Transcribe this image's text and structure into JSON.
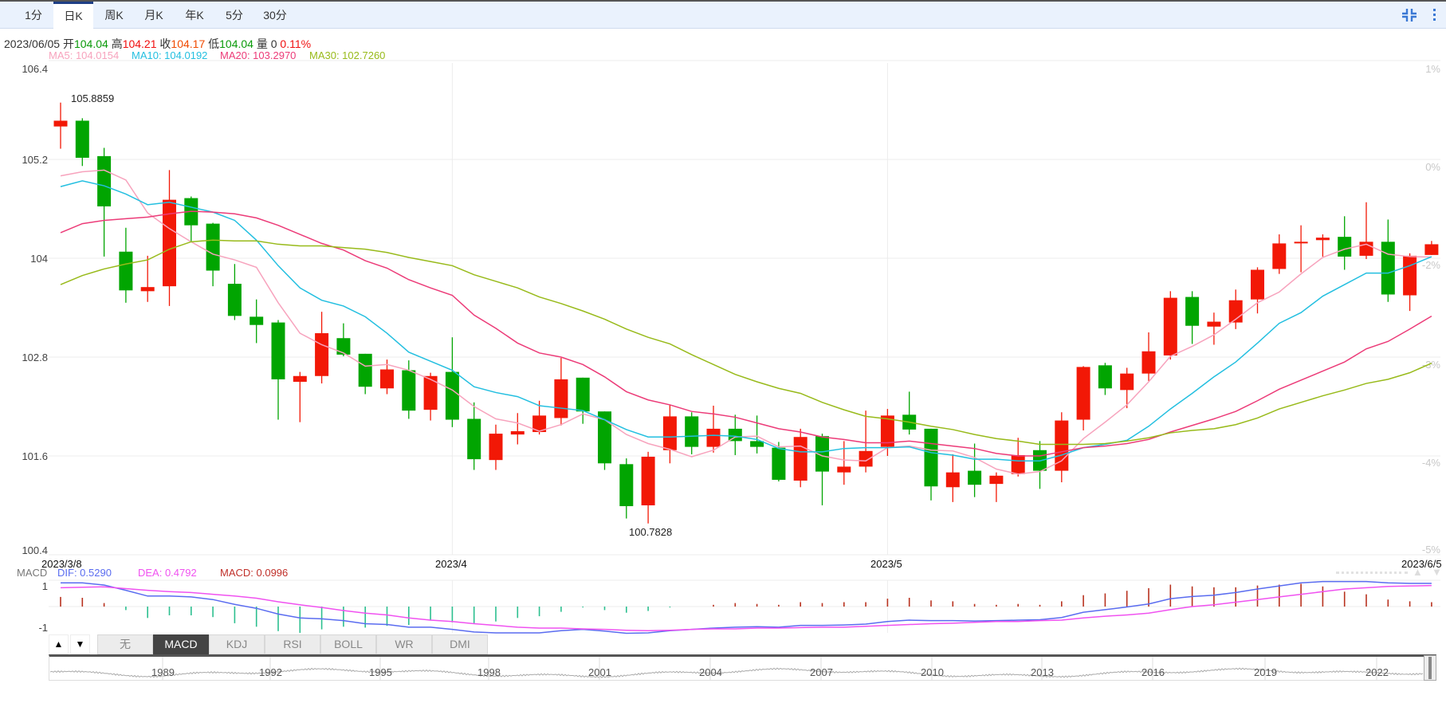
{
  "tabs": [
    "1分",
    "日K",
    "周K",
    "月K",
    "年K",
    "5分",
    "30分"
  ],
  "active_tab": 1,
  "icons": {
    "compress": "compress-icon",
    "more": "kebab-menu-icon"
  },
  "info": {
    "date": "2023/06/05",
    "open_label": "开",
    "open": "104.04",
    "high_label": "高",
    "high": "104.21",
    "close_label": "收",
    "close": "104.17",
    "low_label": "低",
    "low": "104.04",
    "vol_label": "量",
    "vol": "0",
    "change": "0.11%"
  },
  "ma_legend": {
    "ma5": "MA5: 104.0154",
    "ma10": "MA10: 104.0192",
    "ma20": "MA20: 103.2970",
    "ma30": "MA30: 102.7260"
  },
  "colors": {
    "up": "#f21806",
    "down": "#01a501",
    "ma5": "#f7a3bd",
    "ma10": "#23bfe0",
    "ma20": "#ec3b78",
    "ma30": "#98ba1a",
    "dif": "#5a6cf0",
    "dea": "#f052f0",
    "hist_up": "#b8321f",
    "hist_down": "#2cbf8f"
  },
  "chart_data": [
    {
      "type": "candlestick",
      "title": "日K",
      "y_ticks": [
        "106.4",
        "105.2",
        "104",
        "102.8",
        "101.6",
        "100.4"
      ],
      "y_tick_values": [
        106.4,
        105.2,
        104,
        102.8,
        101.6,
        100.4
      ],
      "ylim": [
        100.4,
        106.4
      ],
      "pct_ticks": [
        "1%",
        "0%",
        "-2%",
        "-3%",
        "-4%",
        "-5%"
      ],
      "x_labels": [
        "2023/3/8",
        "2023/4",
        "2023/5",
        "2023/6/5"
      ],
      "x_label_index": [
        0,
        18,
        38,
        63
      ],
      "max_label": "105.8859",
      "max_index": 0,
      "min_label": "100.7828",
      "min_index": 27,
      "grid": true,
      "ohlc": [
        [
          105.6,
          105.89,
          105.33,
          105.67
        ],
        [
          105.67,
          105.7,
          105.12,
          105.22
        ],
        [
          105.24,
          105.34,
          104.02,
          104.63
        ],
        [
          104.08,
          104.37,
          103.46,
          103.61
        ],
        [
          103.6,
          104.03,
          103.47,
          103.65
        ],
        [
          103.66,
          105.07,
          103.42,
          104.71
        ],
        [
          104.73,
          104.75,
          104.2,
          104.4
        ],
        [
          104.42,
          104.43,
          103.66,
          103.85
        ],
        [
          103.69,
          103.93,
          103.25,
          103.3
        ],
        [
          103.29,
          103.5,
          102.97,
          103.19
        ],
        [
          103.22,
          103.25,
          102.04,
          102.53
        ],
        [
          102.5,
          102.62,
          102.01,
          102.57
        ],
        [
          102.57,
          103.35,
          102.48,
          103.09
        ],
        [
          103.03,
          103.21,
          102.81,
          102.83
        ],
        [
          102.84,
          102.84,
          102.35,
          102.44
        ],
        [
          102.42,
          102.77,
          102.35,
          102.65
        ],
        [
          102.64,
          102.76,
          102.05,
          102.15
        ],
        [
          102.16,
          102.61,
          102.03,
          102.57
        ],
        [
          102.62,
          103.04,
          101.95,
          102.04
        ],
        [
          102.05,
          102.25,
          101.43,
          101.56
        ],
        [
          101.55,
          101.98,
          101.43,
          101.87
        ],
        [
          101.86,
          102.12,
          101.74,
          101.9
        ],
        [
          101.89,
          102.27,
          101.86,
          102.09
        ],
        [
          102.06,
          102.79,
          101.97,
          102.53
        ],
        [
          102.55,
          102.55,
          101.99,
          102.14
        ],
        [
          102.14,
          102.14,
          101.43,
          101.51
        ],
        [
          101.5,
          101.57,
          100.84,
          100.99
        ],
        [
          101.0,
          101.65,
          100.78,
          101.59
        ],
        [
          101.67,
          102.22,
          101.51,
          102.08
        ],
        [
          102.08,
          102.13,
          101.62,
          101.71
        ],
        [
          101.71,
          102.21,
          101.64,
          101.93
        ],
        [
          101.93,
          102.1,
          101.61,
          101.78
        ],
        [
          101.78,
          102.09,
          101.63,
          101.71
        ],
        [
          101.7,
          101.77,
          101.29,
          101.31
        ],
        [
          101.3,
          101.93,
          101.22,
          101.83
        ],
        [
          101.84,
          101.87,
          101.0,
          101.41
        ],
        [
          101.4,
          101.78,
          101.25,
          101.47
        ],
        [
          101.47,
          102.15,
          101.4,
          101.66
        ],
        [
          101.71,
          102.17,
          101.6,
          102.09
        ],
        [
          102.1,
          102.38,
          101.86,
          101.92
        ],
        [
          101.93,
          101.93,
          101.06,
          101.23
        ],
        [
          101.22,
          101.62,
          101.04,
          101.4
        ],
        [
          101.42,
          101.75,
          101.1,
          101.25
        ],
        [
          101.26,
          101.4,
          101.04,
          101.36
        ],
        [
          101.38,
          101.82,
          101.35,
          101.61
        ],
        [
          101.67,
          101.78,
          101.2,
          101.42
        ],
        [
          101.42,
          102.13,
          101.28,
          102.03
        ],
        [
          102.04,
          102.69,
          101.91,
          102.68
        ],
        [
          102.7,
          102.73,
          102.34,
          102.42
        ],
        [
          102.4,
          102.67,
          102.18,
          102.6
        ],
        [
          102.6,
          103.1,
          102.51,
          102.87
        ],
        [
          102.82,
          103.6,
          102.77,
          103.52
        ],
        [
          103.53,
          103.6,
          102.96,
          103.18
        ],
        [
          103.17,
          103.34,
          102.95,
          103.23
        ],
        [
          103.22,
          103.62,
          103.14,
          103.49
        ],
        [
          103.5,
          103.89,
          103.33,
          103.86
        ],
        [
          103.87,
          104.29,
          103.81,
          104.18
        ],
        [
          104.19,
          104.4,
          103.83,
          104.2
        ],
        [
          104.22,
          104.29,
          104.02,
          104.25
        ],
        [
          104.26,
          104.51,
          103.86,
          104.02
        ],
        [
          104.03,
          104.68,
          103.99,
          104.2
        ],
        [
          104.2,
          104.47,
          103.47,
          103.56
        ],
        [
          103.55,
          104.06,
          103.36,
          104.03
        ],
        [
          104.04,
          104.21,
          104.04,
          104.17
        ]
      ],
      "series": [
        {
          "name": "MA5",
          "values": [
            105.0,
            105.05,
            105.07,
            104.95,
            104.55,
            104.36,
            104.2,
            104.05,
            103.98,
            103.89,
            103.46,
            103.09,
            102.95,
            102.85,
            102.69,
            102.71,
            102.64,
            102.53,
            102.4,
            102.2,
            102.05,
            102.0,
            101.9,
            101.98,
            102.11,
            102.04,
            101.86,
            101.75,
            101.68,
            101.59,
            101.67,
            101.83,
            101.84,
            101.71,
            101.72,
            101.6,
            101.55,
            101.54,
            101.7,
            101.72,
            101.67,
            101.66,
            101.58,
            101.44,
            101.38,
            101.41,
            101.54,
            101.81,
            102.01,
            102.22,
            102.5,
            102.81,
            102.93,
            103.07,
            103.26,
            103.46,
            103.59,
            103.81,
            104.01,
            104.11,
            104.17,
            104.05,
            104.02,
            104.0154
          ]
        },
        {
          "name": "MA10",
          "values": [
            104.87,
            104.94,
            104.88,
            104.78,
            104.65,
            104.68,
            104.62,
            104.56,
            104.46,
            104.22,
            103.91,
            103.64,
            103.49,
            103.42,
            103.29,
            103.09,
            102.86,
            102.75,
            102.64,
            102.44,
            102.37,
            102.32,
            102.21,
            102.18,
            102.15,
            102.04,
            101.92,
            101.83,
            101.83,
            101.84,
            101.85,
            101.84,
            101.8,
            101.69,
            101.65,
            101.65,
            101.69,
            101.7,
            101.7,
            101.71,
            101.64,
            101.61,
            101.56,
            101.56,
            101.54,
            101.54,
            101.61,
            101.7,
            101.74,
            101.79,
            101.96,
            102.17,
            102.36,
            102.56,
            102.74,
            102.97,
            103.21,
            103.34,
            103.54,
            103.68,
            103.82,
            103.82,
            103.91,
            104.0192
          ]
        },
        {
          "name": "MA20",
          "values": [
            104.31,
            104.42,
            104.46,
            104.48,
            104.5,
            104.54,
            104.57,
            104.56,
            104.54,
            104.49,
            104.4,
            104.29,
            104.18,
            104.1,
            103.97,
            103.88,
            103.74,
            103.64,
            103.55,
            103.31,
            103.15,
            102.97,
            102.85,
            102.8,
            102.71,
            102.56,
            102.38,
            102.28,
            102.22,
            102.14,
            102.11,
            102.07,
            102.0,
            101.93,
            101.89,
            101.83,
            101.8,
            101.76,
            101.76,
            101.78,
            101.75,
            101.72,
            101.69,
            101.63,
            101.6,
            101.6,
            101.65,
            101.7,
            101.72,
            101.75,
            101.8,
            101.89,
            101.97,
            102.05,
            102.14,
            102.27,
            102.41,
            102.52,
            102.63,
            102.74,
            102.9,
            102.99,
            103.14,
            103.297
          ]
        },
        {
          "name": "MA30",
          "values": [
            103.68,
            103.79,
            103.87,
            103.93,
            103.98,
            104.11,
            104.2,
            104.22,
            104.21,
            104.21,
            104.17,
            104.15,
            104.15,
            104.13,
            104.11,
            104.07,
            104.01,
            103.96,
            103.91,
            103.8,
            103.72,
            103.64,
            103.53,
            103.45,
            103.36,
            103.26,
            103.14,
            103.04,
            102.96,
            102.83,
            102.71,
            102.59,
            102.5,
            102.42,
            102.36,
            102.25,
            102.16,
            102.08,
            102.05,
            102.01,
            101.96,
            101.92,
            101.86,
            101.81,
            101.78,
            101.74,
            101.74,
            101.74,
            101.75,
            101.78,
            101.82,
            101.88,
            101.91,
            101.93,
            101.98,
            102.06,
            102.17,
            102.25,
            102.33,
            102.4,
            102.48,
            102.53,
            102.61,
            102.726
          ]
        }
      ]
    },
    {
      "type": "line",
      "title": "MACD",
      "legend": {
        "name": "MACD",
        "dif": "DIF: 0.5290",
        "dea": "DEA: 0.4792",
        "macd": "MACD: 0.0996"
      },
      "y_ticks": [
        "1",
        "-1"
      ],
      "ylim": [
        -0.6,
        0.6
      ],
      "series": [
        {
          "name": "DIF",
          "values": [
            0.54,
            0.54,
            0.49,
            0.37,
            0.24,
            0.24,
            0.22,
            0.16,
            0.05,
            -0.04,
            -0.17,
            -0.26,
            -0.28,
            -0.32,
            -0.39,
            -0.41,
            -0.47,
            -0.47,
            -0.52,
            -0.58,
            -0.6,
            -0.6,
            -0.6,
            -0.55,
            -0.52,
            -0.56,
            -0.61,
            -0.6,
            -0.55,
            -0.52,
            -0.49,
            -0.47,
            -0.46,
            -0.47,
            -0.43,
            -0.43,
            -0.42,
            -0.4,
            -0.34,
            -0.31,
            -0.32,
            -0.32,
            -0.33,
            -0.32,
            -0.31,
            -0.3,
            -0.25,
            -0.13,
            -0.07,
            -0.01,
            0.06,
            0.18,
            0.23,
            0.26,
            0.32,
            0.4,
            0.47,
            0.54,
            0.57,
            0.57,
            0.57,
            0.54,
            0.53,
            0.529
          ]
        },
        {
          "name": "DEA",
          "values": [
            0.43,
            0.44,
            0.45,
            0.41,
            0.37,
            0.34,
            0.32,
            0.28,
            0.24,
            0.19,
            0.11,
            0.04,
            -0.02,
            -0.09,
            -0.15,
            -0.19,
            -0.26,
            -0.31,
            -0.34,
            -0.39,
            -0.43,
            -0.47,
            -0.49,
            -0.49,
            -0.51,
            -0.52,
            -0.54,
            -0.55,
            -0.54,
            -0.52,
            -0.51,
            -0.51,
            -0.49,
            -0.49,
            -0.48,
            -0.47,
            -0.47,
            -0.45,
            -0.43,
            -0.41,
            -0.39,
            -0.38,
            -0.36,
            -0.34,
            -0.34,
            -0.32,
            -0.31,
            -0.26,
            -0.22,
            -0.19,
            -0.15,
            -0.07,
            0.0,
            0.04,
            0.1,
            0.16,
            0.22,
            0.28,
            0.34,
            0.4,
            0.43,
            0.46,
            0.47,
            0.479
          ]
        }
      ]
    }
  ],
  "indicator_buttons": [
    "无",
    "MACD",
    "KDJ",
    "RSI",
    "BOLL",
    "WR",
    "DMI"
  ],
  "active_indicator": 1,
  "scroll_buttons": {
    "up": "▲",
    "down": "▼"
  },
  "navigator": {
    "years": [
      "1989",
      "1992",
      "1995",
      "1998",
      "2001",
      "2004",
      "2007",
      "2010",
      "2013",
      "2016",
      "2019",
      "2022"
    ]
  }
}
